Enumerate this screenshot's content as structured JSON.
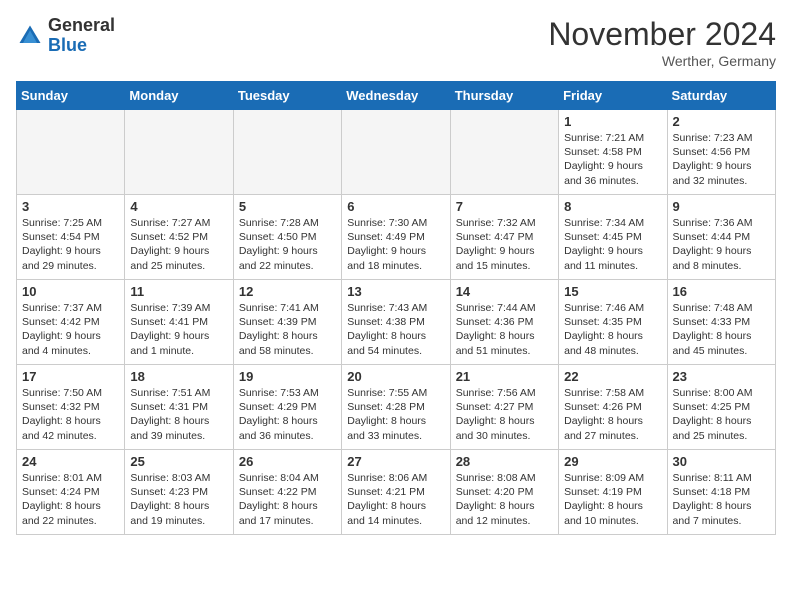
{
  "header": {
    "logo_general": "General",
    "logo_blue": "Blue",
    "month_title": "November 2024",
    "location": "Werther, Germany"
  },
  "days_of_week": [
    "Sunday",
    "Monday",
    "Tuesday",
    "Wednesday",
    "Thursday",
    "Friday",
    "Saturday"
  ],
  "weeks": [
    [
      {
        "num": "",
        "info": ""
      },
      {
        "num": "",
        "info": ""
      },
      {
        "num": "",
        "info": ""
      },
      {
        "num": "",
        "info": ""
      },
      {
        "num": "",
        "info": ""
      },
      {
        "num": "1",
        "info": "Sunrise: 7:21 AM\nSunset: 4:58 PM\nDaylight: 9 hours and 36 minutes."
      },
      {
        "num": "2",
        "info": "Sunrise: 7:23 AM\nSunset: 4:56 PM\nDaylight: 9 hours and 32 minutes."
      }
    ],
    [
      {
        "num": "3",
        "info": "Sunrise: 7:25 AM\nSunset: 4:54 PM\nDaylight: 9 hours and 29 minutes."
      },
      {
        "num": "4",
        "info": "Sunrise: 7:27 AM\nSunset: 4:52 PM\nDaylight: 9 hours and 25 minutes."
      },
      {
        "num": "5",
        "info": "Sunrise: 7:28 AM\nSunset: 4:50 PM\nDaylight: 9 hours and 22 minutes."
      },
      {
        "num": "6",
        "info": "Sunrise: 7:30 AM\nSunset: 4:49 PM\nDaylight: 9 hours and 18 minutes."
      },
      {
        "num": "7",
        "info": "Sunrise: 7:32 AM\nSunset: 4:47 PM\nDaylight: 9 hours and 15 minutes."
      },
      {
        "num": "8",
        "info": "Sunrise: 7:34 AM\nSunset: 4:45 PM\nDaylight: 9 hours and 11 minutes."
      },
      {
        "num": "9",
        "info": "Sunrise: 7:36 AM\nSunset: 4:44 PM\nDaylight: 9 hours and 8 minutes."
      }
    ],
    [
      {
        "num": "10",
        "info": "Sunrise: 7:37 AM\nSunset: 4:42 PM\nDaylight: 9 hours and 4 minutes."
      },
      {
        "num": "11",
        "info": "Sunrise: 7:39 AM\nSunset: 4:41 PM\nDaylight: 9 hours and 1 minute."
      },
      {
        "num": "12",
        "info": "Sunrise: 7:41 AM\nSunset: 4:39 PM\nDaylight: 8 hours and 58 minutes."
      },
      {
        "num": "13",
        "info": "Sunrise: 7:43 AM\nSunset: 4:38 PM\nDaylight: 8 hours and 54 minutes."
      },
      {
        "num": "14",
        "info": "Sunrise: 7:44 AM\nSunset: 4:36 PM\nDaylight: 8 hours and 51 minutes."
      },
      {
        "num": "15",
        "info": "Sunrise: 7:46 AM\nSunset: 4:35 PM\nDaylight: 8 hours and 48 minutes."
      },
      {
        "num": "16",
        "info": "Sunrise: 7:48 AM\nSunset: 4:33 PM\nDaylight: 8 hours and 45 minutes."
      }
    ],
    [
      {
        "num": "17",
        "info": "Sunrise: 7:50 AM\nSunset: 4:32 PM\nDaylight: 8 hours and 42 minutes."
      },
      {
        "num": "18",
        "info": "Sunrise: 7:51 AM\nSunset: 4:31 PM\nDaylight: 8 hours and 39 minutes."
      },
      {
        "num": "19",
        "info": "Sunrise: 7:53 AM\nSunset: 4:29 PM\nDaylight: 8 hours and 36 minutes."
      },
      {
        "num": "20",
        "info": "Sunrise: 7:55 AM\nSunset: 4:28 PM\nDaylight: 8 hours and 33 minutes."
      },
      {
        "num": "21",
        "info": "Sunrise: 7:56 AM\nSunset: 4:27 PM\nDaylight: 8 hours and 30 minutes."
      },
      {
        "num": "22",
        "info": "Sunrise: 7:58 AM\nSunset: 4:26 PM\nDaylight: 8 hours and 27 minutes."
      },
      {
        "num": "23",
        "info": "Sunrise: 8:00 AM\nSunset: 4:25 PM\nDaylight: 8 hours and 25 minutes."
      }
    ],
    [
      {
        "num": "24",
        "info": "Sunrise: 8:01 AM\nSunset: 4:24 PM\nDaylight: 8 hours and 22 minutes."
      },
      {
        "num": "25",
        "info": "Sunrise: 8:03 AM\nSunset: 4:23 PM\nDaylight: 8 hours and 19 minutes."
      },
      {
        "num": "26",
        "info": "Sunrise: 8:04 AM\nSunset: 4:22 PM\nDaylight: 8 hours and 17 minutes."
      },
      {
        "num": "27",
        "info": "Sunrise: 8:06 AM\nSunset: 4:21 PM\nDaylight: 8 hours and 14 minutes."
      },
      {
        "num": "28",
        "info": "Sunrise: 8:08 AM\nSunset: 4:20 PM\nDaylight: 8 hours and 12 minutes."
      },
      {
        "num": "29",
        "info": "Sunrise: 8:09 AM\nSunset: 4:19 PM\nDaylight: 8 hours and 10 minutes."
      },
      {
        "num": "30",
        "info": "Sunrise: 8:11 AM\nSunset: 4:18 PM\nDaylight: 8 hours and 7 minutes."
      }
    ]
  ]
}
